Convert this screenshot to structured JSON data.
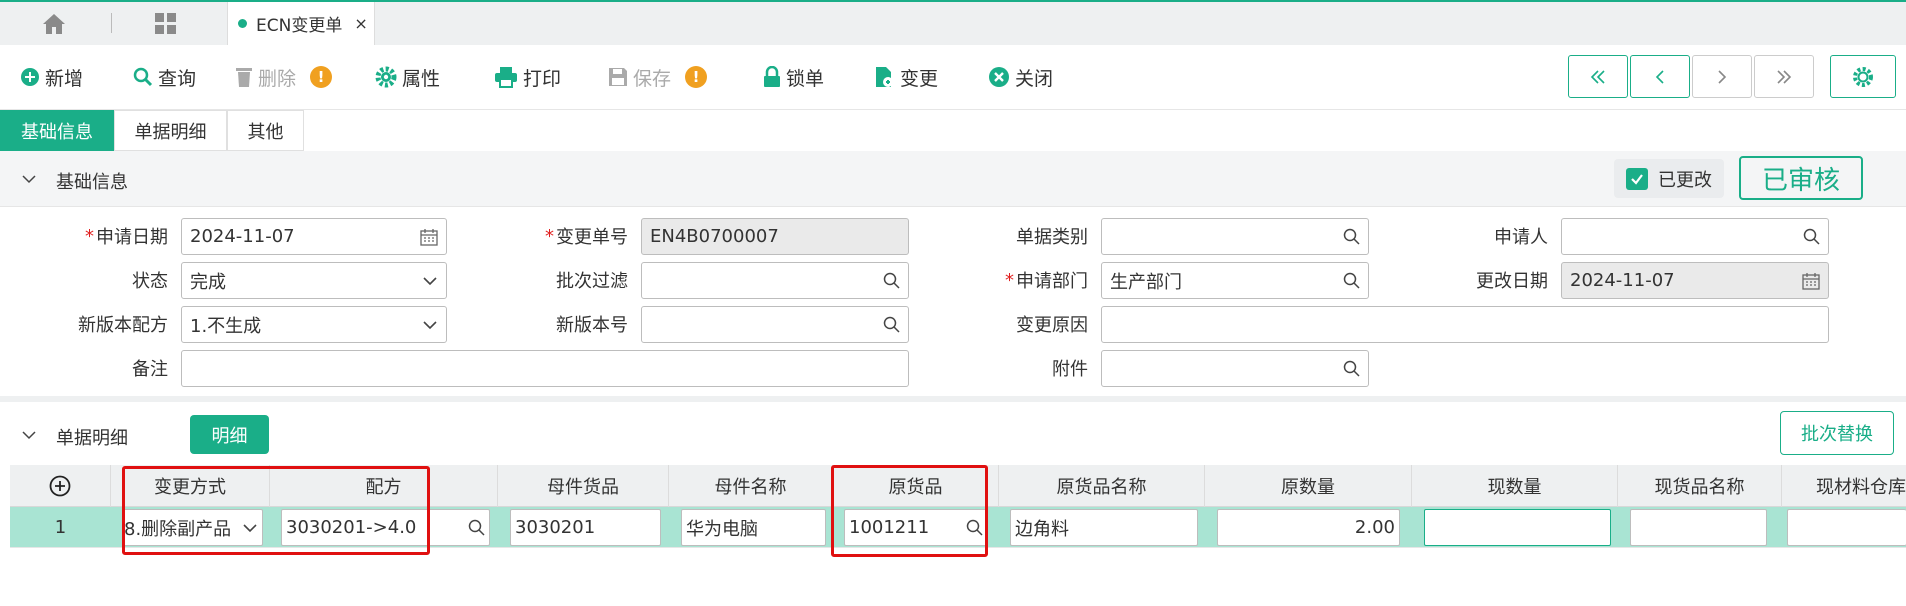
{
  "tabs": {
    "home_icon": "home-icon",
    "apps_icon": "apps-grid-icon",
    "doc_tab": "ECN变更单",
    "close": "×"
  },
  "toolbar": {
    "add": "新增",
    "query": "查询",
    "delete": "删除",
    "props": "属性",
    "print": "打印",
    "save": "保存",
    "lock": "锁单",
    "change": "变更",
    "close": "关闭",
    "warn": "!"
  },
  "nav": {
    "first": "«",
    "prev": "‹",
    "next": "›",
    "last": "»"
  },
  "subtabs": [
    "基础信息",
    "单据明细",
    "其他"
  ],
  "basic": {
    "section": "基础信息",
    "modified": "已更改",
    "stamp": "已审核",
    "apply_date_label": "申请日期",
    "apply_date": "2024-11-07",
    "change_no_label": "变更单号",
    "change_no": "EN4B0700007",
    "doc_type_label": "单据类别",
    "doc_type": "",
    "applicant_label": "申请人",
    "applicant": "",
    "status_label": "状态",
    "status": "完成",
    "batch_filter_label": "批次过滤",
    "batch_filter": "",
    "dept_label": "申请部门",
    "dept": "生产部门",
    "change_date_label": "更改日期",
    "change_date": "2024-11-07",
    "new_recipe_label": "新版本配方",
    "new_recipe": "1.不生成",
    "new_ver_label": "新版本号",
    "new_ver": "",
    "reason_label": "变更原因",
    "reason": "",
    "remark_label": "备注",
    "remark": "",
    "attach_label": "附件",
    "attach": "",
    "req": "*"
  },
  "detail": {
    "section": "单据明细",
    "tab": "明细",
    "batch_replace": "批次替换",
    "columns": [
      "变更方式",
      "配方",
      "母件货品",
      "母件名称",
      "原货品",
      "原货品名称",
      "原数量",
      "现数量",
      "现货品名称",
      "现材料仓库"
    ],
    "row": {
      "no": "1",
      "method": "8.删除副产品",
      "recipe": "3030201->4.0",
      "parent": "3030201",
      "parent_name": "华为电脑",
      "orig": "1001211",
      "orig_name": "边角料",
      "orig_qty": "2.00",
      "cur_qty": "",
      "cur_name": "",
      "cur_wh": ""
    }
  },
  "colors": {
    "accent": "#1aae88",
    "row": "#a9e4d3",
    "warn": "#f0a020",
    "highlight": "#e01010"
  }
}
